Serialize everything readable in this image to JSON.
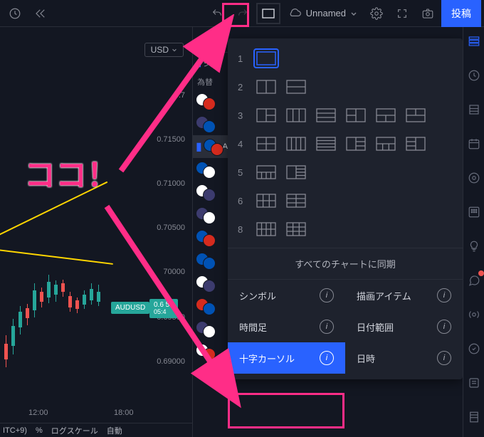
{
  "topbar": {
    "save_name": "Unnamed",
    "publish_label": "投稿"
  },
  "chart": {
    "currency": "USD",
    "symbol_badge": "AUDUSD",
    "price_badge_line1": "0.6 53",
    "price_badge_line2": "05:4",
    "y_ticks": [
      "0.7",
      "0.71500",
      "0.71000",
      "0.70500",
      "70000",
      "0.69500",
      "0.69000"
    ],
    "x_ticks": [
      "12:00",
      "18:00"
    ],
    "bottom": {
      "tz": "ITC+9)",
      "pct": "%",
      "log": "ログスケール",
      "auto": "自動"
    }
  },
  "watchlist": {
    "header": "オ",
    "symbol_label": "シン",
    "fx_label": "為替",
    "pair_letter": "A"
  },
  "layout_panel": {
    "rows": [
      "1",
      "2",
      "3",
      "4",
      "5",
      "6",
      "8"
    ],
    "sync_label": "すべてのチャートに同期",
    "options": [
      {
        "label": "シンボル",
        "key": "symbol"
      },
      {
        "label": "描画アイテム",
        "key": "drawings"
      },
      {
        "label": "時間足",
        "key": "interval"
      },
      {
        "label": "日付範囲",
        "key": "date-range"
      },
      {
        "label": "十字カーソル",
        "key": "crosshair",
        "highlighted": true
      },
      {
        "label": "日時",
        "key": "time"
      }
    ]
  },
  "annotation": {
    "text": "ココ！"
  }
}
